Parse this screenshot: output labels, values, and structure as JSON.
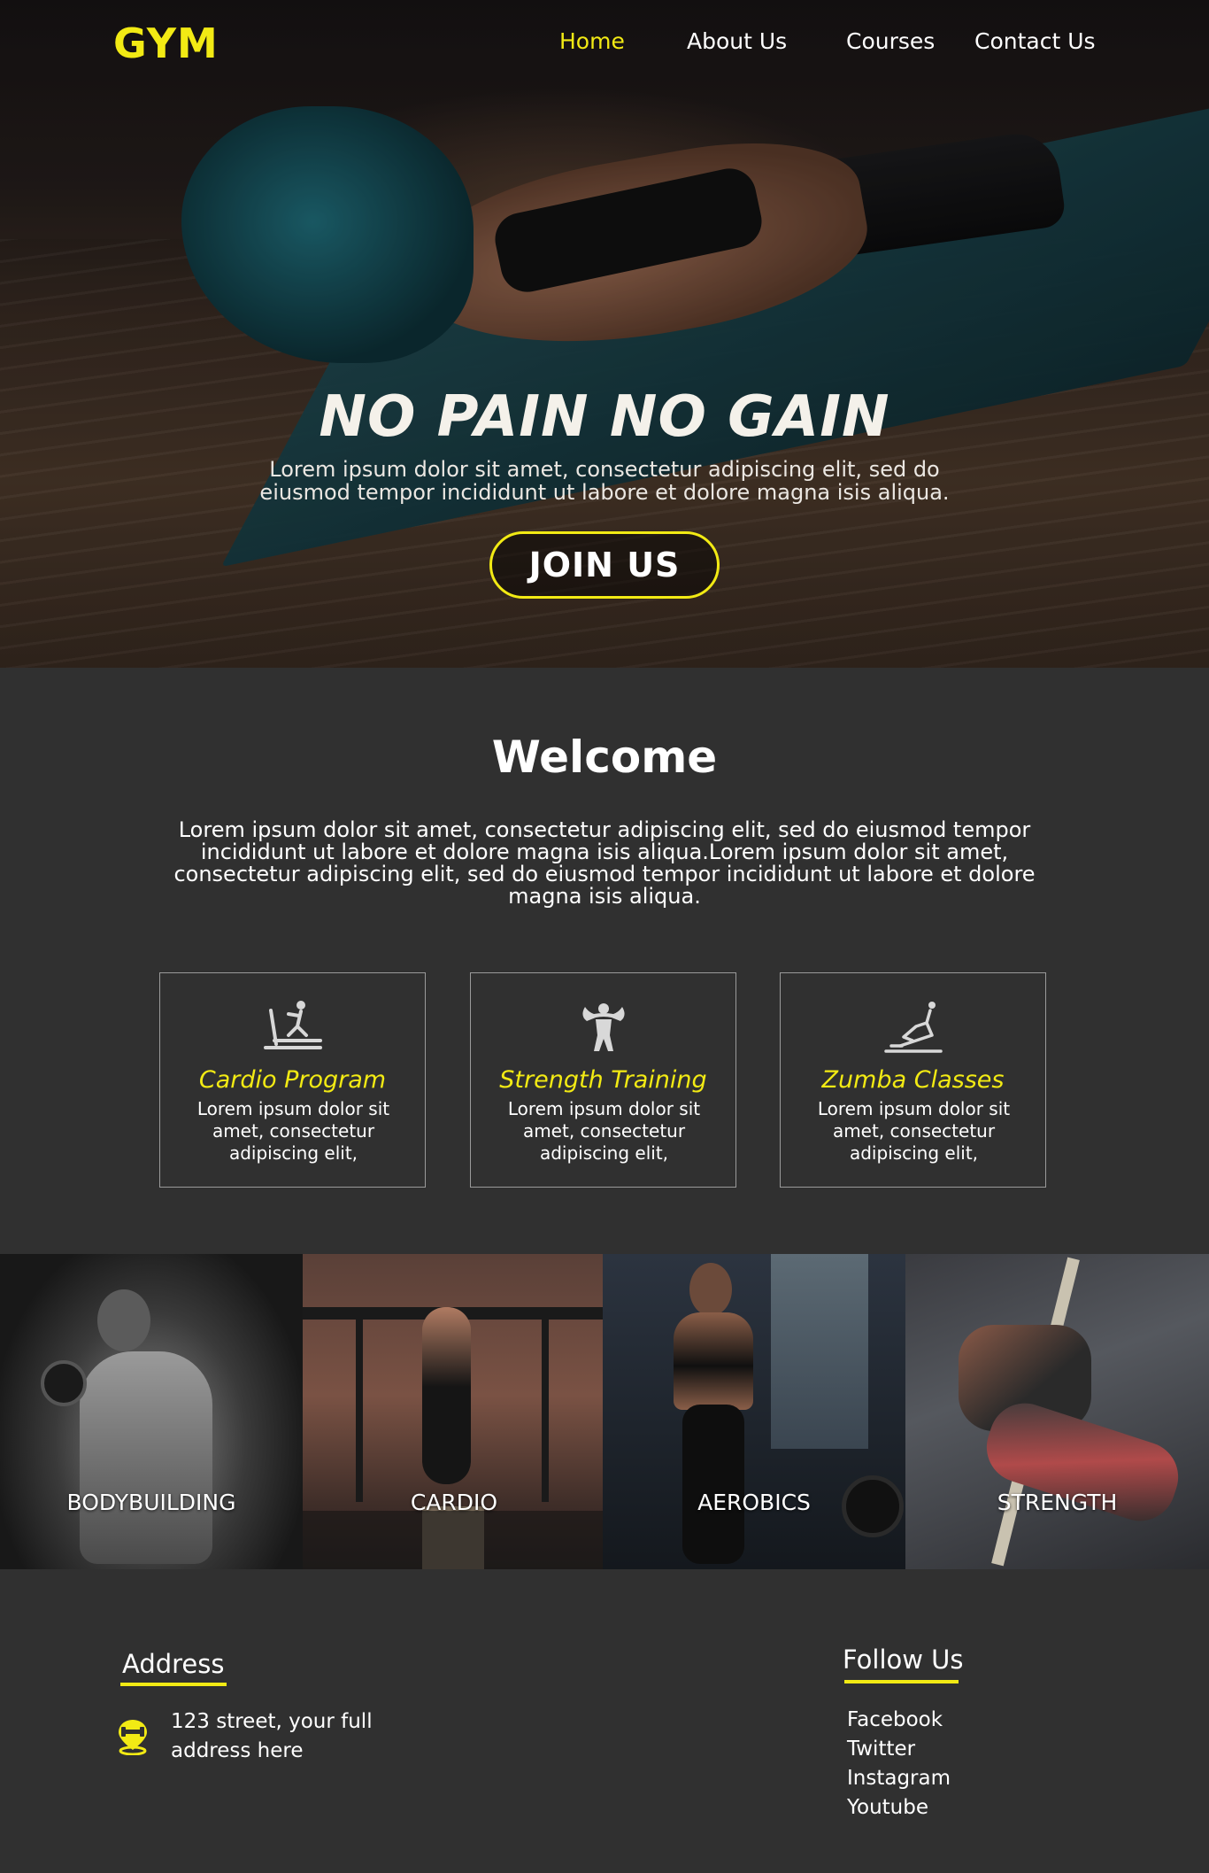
{
  "header": {
    "logo": "GYM",
    "nav": [
      {
        "label": "Home",
        "active": true
      },
      {
        "label": "About Us",
        "active": false
      },
      {
        "label": "Courses",
        "active": false
      },
      {
        "label": "Contact Us",
        "active": false
      }
    ]
  },
  "hero": {
    "title": "NO PAIN NO GAIN",
    "subtitle": "Lorem ipsum dolor sit amet, consectetur adipiscing elit, sed do eiusmod tempor incididunt ut labore et dolore magna isis aliqua.",
    "cta_label": "JOIN US"
  },
  "welcome": {
    "title": "Welcome",
    "text": "Lorem ipsum dolor sit amet, consectetur adipiscing elit, sed do eiusmod tempor incididunt ut labore et dolore magna isis aliqua.Lorem ipsum dolor sit amet, consectetur adipiscing elit, sed do eiusmod tempor incididunt ut labore et dolore magna isis aliqua."
  },
  "programs": [
    {
      "icon": "treadmill-icon",
      "title": "Cardio Program",
      "text": "Lorem ipsum dolor sit amet, consectetur adipiscing elit,"
    },
    {
      "icon": "bodybuilder-icon",
      "title": "Strength Training",
      "text": "Lorem ipsum dolor sit amet, consectetur adipiscing elit,"
    },
    {
      "icon": "stretching-icon",
      "title": "Zumba Classes",
      "text": "Lorem ipsum dolor sit amet, consectetur adipiscing elit,"
    }
  ],
  "gallery": [
    {
      "label": "BODYBUILDING"
    },
    {
      "label": "CARDIO"
    },
    {
      "label": "AEROBICS"
    },
    {
      "label": "STRENGTH"
    }
  ],
  "footer": {
    "address_title": "Address",
    "address_icon": "location-pin-icon",
    "address_text": "123 street, your full address here",
    "follow_title": "Follow Us",
    "social": [
      "Facebook",
      "Twitter",
      "Instagram",
      "Youtube"
    ]
  },
  "colors": {
    "accent": "#f2ea14",
    "background": "#303030"
  }
}
